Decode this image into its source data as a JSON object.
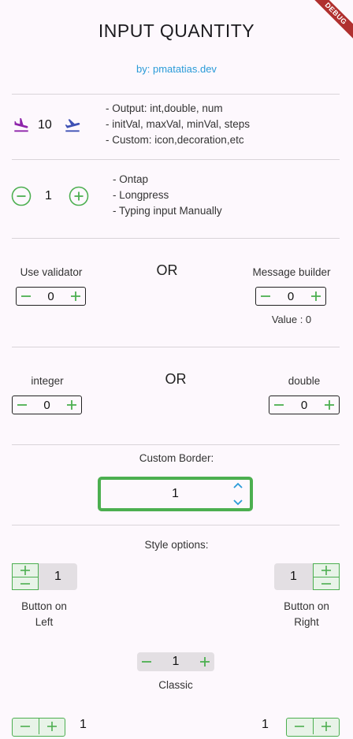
{
  "app": {
    "title": "INPUT QUANTITY",
    "author": "by: pmatatias.dev",
    "debug_banner": "DEBUG"
  },
  "colors": {
    "accent_green": "#4caf50",
    "accent_purple": "#8e24aa",
    "accent_indigo": "#3f51b5",
    "link_blue": "#2a9bd8",
    "border_green": "#4caf50"
  },
  "section1": {
    "value": "10",
    "lines": [
      "- Output: int,double, num",
      "- initVal, maxVal, minVal, steps",
      "- Custom: icon,decoration,etc"
    ],
    "icons": [
      "flight-land-icon",
      "flight-takeoff-icon"
    ]
  },
  "section2": {
    "value": "1",
    "lines": [
      "- Ontap",
      "- Longpress",
      "- Typing input Manually"
    ]
  },
  "section3": {
    "left_label": "Use validator",
    "or": "OR",
    "right_label": "Message builder",
    "left_value": "0",
    "right_value": "0",
    "message": "Value : 0"
  },
  "section4": {
    "left_label": "integer",
    "or": "OR",
    "right_label": "double",
    "left_value": "0",
    "right_value": "0"
  },
  "section5": {
    "label": "Custom Border:",
    "value": "1"
  },
  "section6": {
    "label": "Style options:",
    "left_value": "1",
    "left_label_line1": "Button on",
    "left_label_line2": "Left",
    "right_value": "1",
    "right_label_line1": "Button on",
    "right_label_line2": "Right",
    "classic_value": "1",
    "classic_label": "Classic",
    "bottom_left_value": "1",
    "bottom_right_value": "1"
  }
}
